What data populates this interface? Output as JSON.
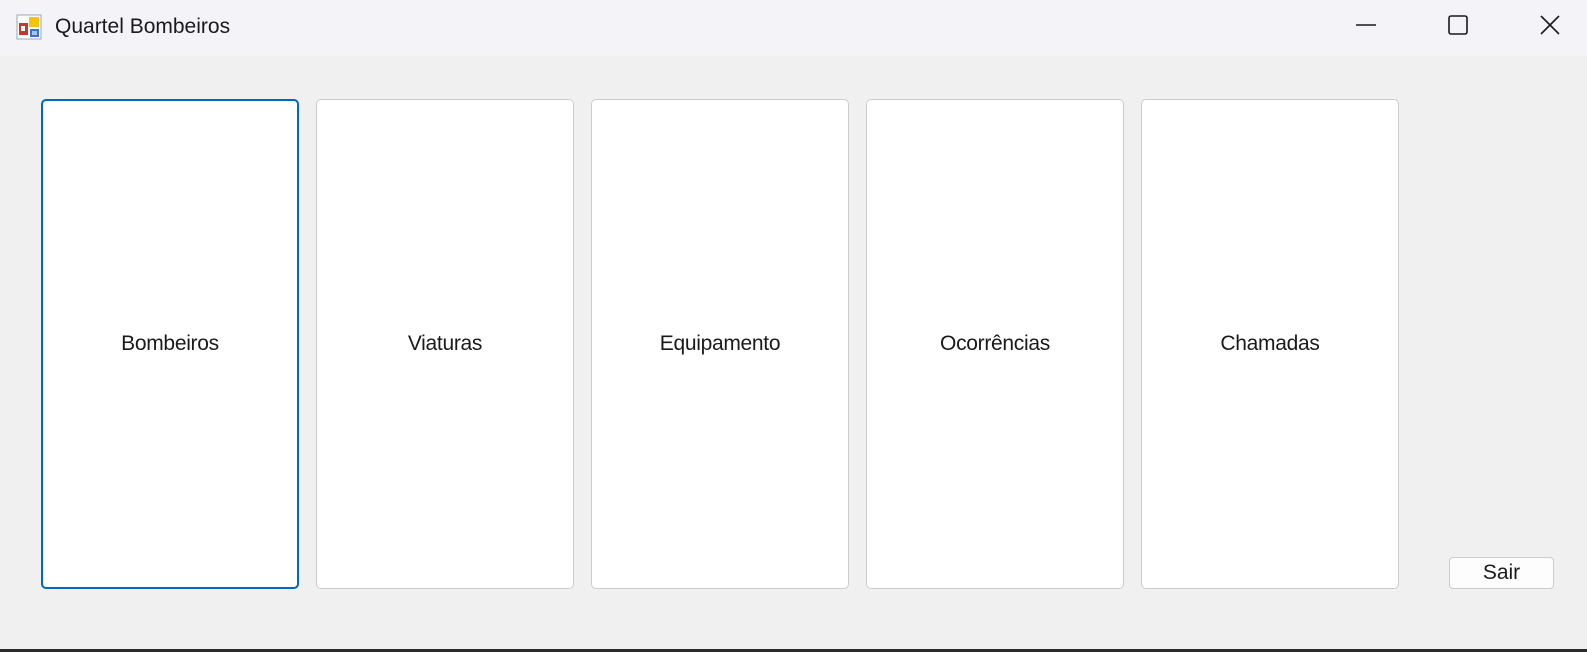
{
  "window": {
    "title": "Quartel Bombeiros",
    "icon": "form-app-icon",
    "controls": {
      "minimize": "minimize-icon",
      "maximize": "maximize-icon",
      "close": "close-icon"
    }
  },
  "main": {
    "buttons": [
      {
        "label": "Bombeiros",
        "focused": true
      },
      {
        "label": "Viaturas",
        "focused": false
      },
      {
        "label": "Equipamento",
        "focused": false
      },
      {
        "label": "Ocorrências",
        "focused": false
      },
      {
        "label": "Chamadas",
        "focused": false
      }
    ],
    "exit_label": "Sair"
  },
  "colors": {
    "focus_accent": "#0067c0",
    "client_background": "#f0f0f0",
    "titlebar_background": "#f3f3f8"
  }
}
